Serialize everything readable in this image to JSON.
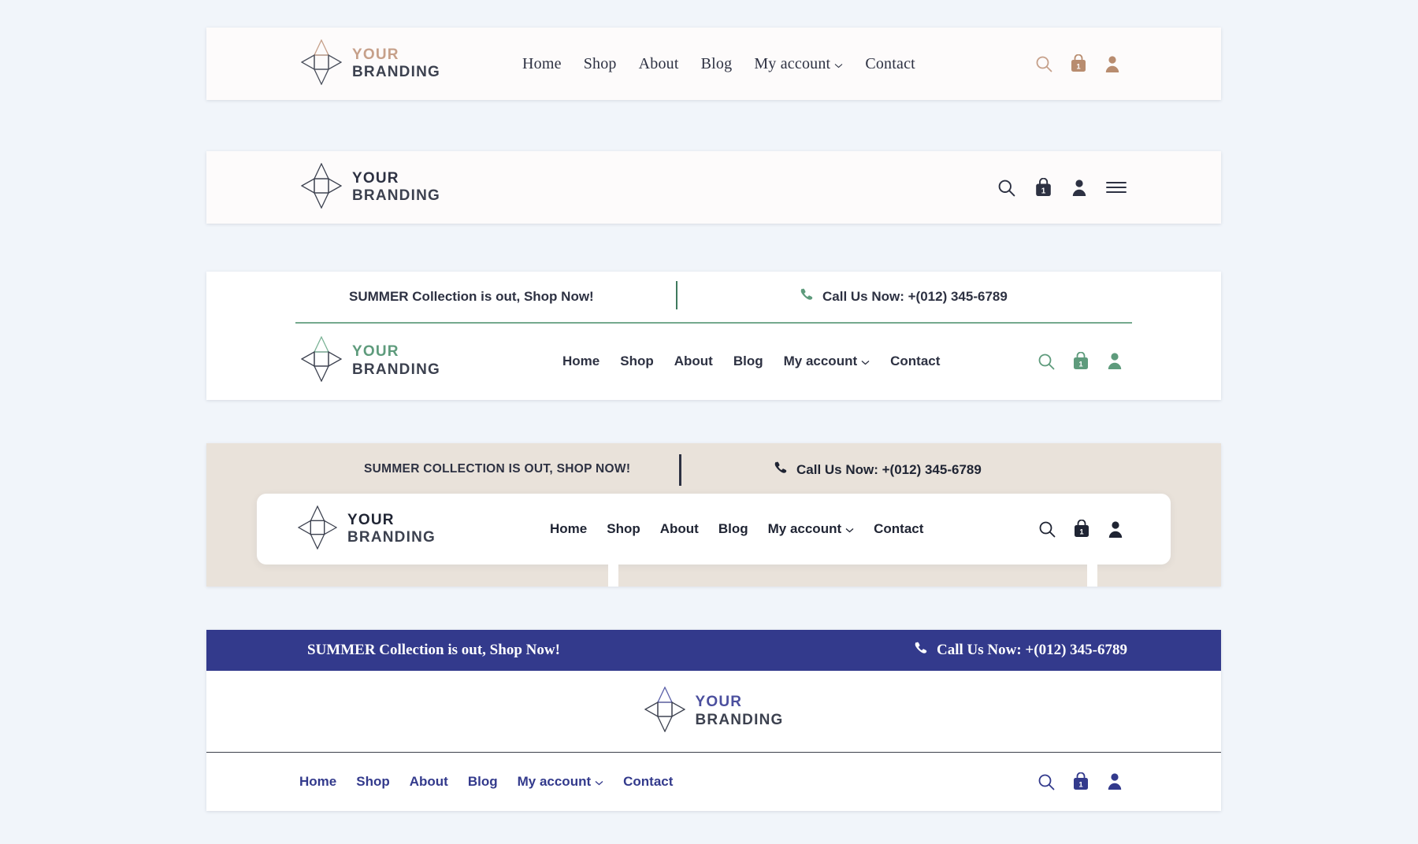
{
  "page": {
    "background": "#f1f5fa"
  },
  "brand": {
    "line1": "YOUR",
    "line2": "BRANDING",
    "logo_icon": "diamond-compass-logo"
  },
  "nav": {
    "home": "Home",
    "shop": "Shop",
    "about": "About",
    "blog": "Blog",
    "my_account": "My account",
    "contact": "Contact"
  },
  "icons": {
    "search": "search-icon",
    "bag": "shopping-bag-icon",
    "account": "user-account-icon",
    "menu": "hamburger-menu-icon",
    "phone": "phone-icon",
    "chevron": "chevron-down-icon"
  },
  "cart": {
    "count": "1"
  },
  "headers": [
    {
      "id": "header-1",
      "style": "serif-nav-light",
      "accent": "#c6a08a",
      "background": "#fdfbfb",
      "brand_accent": "#c6a08a",
      "has_topbar": false,
      "has_hamburger": false
    },
    {
      "id": "header-2",
      "style": "minimal-hamburger",
      "accent": "#2d3142",
      "background": "#fdfbfb",
      "brand_accent": "#2d3142",
      "has_topbar": false,
      "has_hamburger": true
    },
    {
      "id": "header-3",
      "style": "green-topbar",
      "accent": "#5e9b7c",
      "background": "#ffffff",
      "brand_accent": "#5e9b7c",
      "has_topbar": true,
      "has_hamburger": false,
      "topbar": {
        "promo": "SUMMER Collection is out, Shop Now!",
        "phone": "Call Us Now: +(012) 345-6789"
      }
    },
    {
      "id": "header-4",
      "style": "beige-floating-card",
      "accent": "#1f2433",
      "background": "#e9e2da",
      "brand_accent": "#1f2433",
      "has_topbar": true,
      "has_hamburger": false,
      "topbar": {
        "promo": "SUMMER COLLECTION IS OUT, SHOP NOW!",
        "phone": "Call Us Now: +(012) 345-6789"
      }
    },
    {
      "id": "header-5",
      "style": "navy-stacked",
      "accent": "#333a8c",
      "background": "#ffffff",
      "brand_accent": "#4b4f9e",
      "has_topbar": true,
      "has_hamburger": false,
      "topbar": {
        "promo": "SUMMER Collection is out, Shop Now!",
        "phone": "Call Us Now: +(012) 345-6789"
      }
    }
  ]
}
